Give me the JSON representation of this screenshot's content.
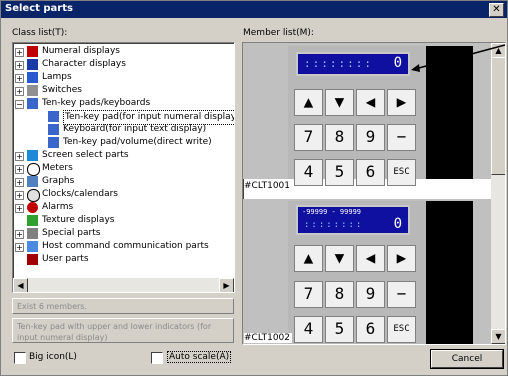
{
  "window": {
    "title": "Select parts",
    "close_glyph": "✕"
  },
  "class_list": {
    "label": "Class list(T):",
    "items": [
      {
        "label": "Numeral displays",
        "expander": "+",
        "icon": "numeral-icon"
      },
      {
        "label": "Character displays",
        "expander": "+",
        "icon": "character-icon"
      },
      {
        "label": "Lamps",
        "expander": "+",
        "icon": "lamp-icon"
      },
      {
        "label": "Switches",
        "expander": "+",
        "icon": "switch-icon"
      },
      {
        "label": "Ten-key pads/keyboards",
        "expander": "−",
        "icon": "tenkey-icon"
      },
      {
        "label": "Ten-key pad(for input numeral display)",
        "icon": "tenkey-child-icon"
      },
      {
        "label": "Keyboard(for input text display)",
        "icon": "tenkey-child-icon"
      },
      {
        "label": "Ten-key pad/volume(direct write)",
        "icon": "tenkey-child-icon"
      },
      {
        "label": "Screen select parts",
        "expander": "+",
        "icon": "screen-icon"
      },
      {
        "label": "Meters",
        "expander": "+",
        "icon": "meter-icon"
      },
      {
        "label": "Graphs",
        "expander": "+",
        "icon": "graph-icon"
      },
      {
        "label": "Clocks/calendars",
        "expander": "+",
        "icon": "clock-icon"
      },
      {
        "label": "Alarms",
        "expander": "+",
        "icon": "alarm-icon"
      },
      {
        "label": "Texture displays",
        "icon": "texture-icon"
      },
      {
        "label": "Special parts",
        "expander": "+",
        "icon": "special-icon"
      },
      {
        "label": "Host command communication parts",
        "expander": "+",
        "icon": "host-icon"
      },
      {
        "label": "User parts",
        "icon": "user-icon"
      }
    ]
  },
  "info": {
    "count": "Exist 6 members.",
    "description": "Ten-key pad with upper and lower indicators (for input numeral display)"
  },
  "options": {
    "big_icon": "Big icon(L)",
    "auto_scale": "Auto scale(A)"
  },
  "member_list": {
    "label": "Member list(M):",
    "members": [
      {
        "id": "#CLT1001",
        "display_top": "",
        "display_bottom": "0"
      },
      {
        "id": "#CLT1002",
        "display_top": "-99999 - 99999",
        "display_bottom": "0"
      }
    ],
    "keys": [
      "▲",
      "▼",
      "◀",
      "▶",
      "7",
      "8",
      "9",
      "−",
      "4",
      "5",
      "6",
      "ESC"
    ]
  },
  "buttons": {
    "cancel": "Cancel"
  },
  "colors": {
    "titlebar": "#0a246a",
    "keypad_display": "#1010a0",
    "dialog_bg": "#d4d0c8"
  }
}
